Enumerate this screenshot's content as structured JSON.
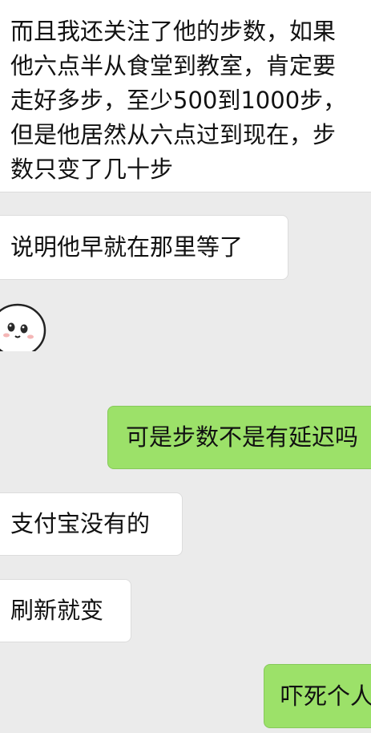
{
  "messages": [
    {
      "side": "incoming",
      "lines": [
        "而且我还关注了他的步数，如果",
        "他六点半从食堂到教室，肯定要",
        "走好多步，至少500到1000步，",
        "但是他居然从六点过到现在，步",
        "数只变了几十步"
      ]
    },
    {
      "side": "incoming",
      "text": "说明他早就在那里等了"
    },
    {
      "side": "incoming",
      "type": "sticker",
      "icon": "cute-face-sticker-icon"
    },
    {
      "side": "outgoing",
      "text": "可是步数不是有延迟吗"
    },
    {
      "side": "incoming",
      "text": "支付宝没有的"
    },
    {
      "side": "incoming",
      "text": "刷新就变"
    },
    {
      "side": "outgoing",
      "text": "吓死个人"
    }
  ],
  "colors": {
    "background": "#ebebeb",
    "incoming_bubble": "#ffffff",
    "outgoing_bubble": "#9ce169"
  }
}
